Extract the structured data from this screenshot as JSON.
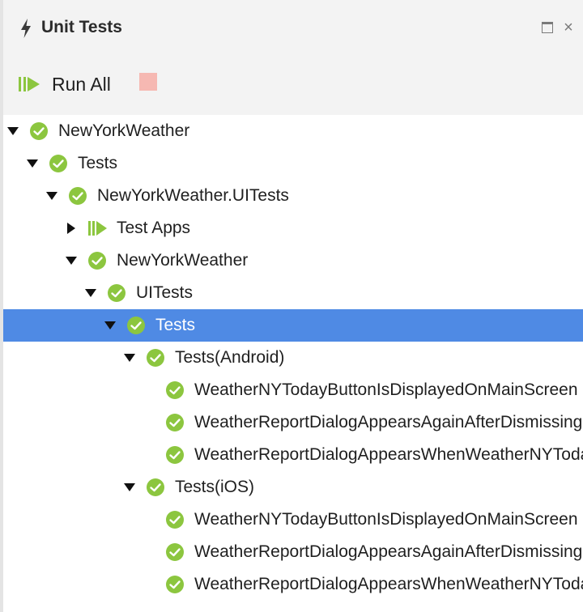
{
  "panel": {
    "title": "Unit Tests",
    "title_icon": "lightning-icon"
  },
  "toolbar": {
    "run_all_label": "Run All",
    "stop_color": "#f6b8b2"
  },
  "colors": {
    "pass_green": "#8cc63f",
    "selection_blue": "#4f8ae4",
    "run_green": "#8cc63f"
  },
  "tree": [
    {
      "label": "NewYorkWeather",
      "depth": 0,
      "toggle": "expanded",
      "icon": "passed-check-icon",
      "selected": false
    },
    {
      "label": "Tests",
      "depth": 1,
      "toggle": "expanded",
      "icon": "passed-check-icon",
      "selected": false
    },
    {
      "label": "NewYorkWeather.UITests",
      "depth": 2,
      "toggle": "expanded",
      "icon": "passed-check-icon",
      "selected": false
    },
    {
      "label": "Test Apps",
      "depth": 3,
      "toggle": "collapsed",
      "icon": "run-apps-icon",
      "selected": false
    },
    {
      "label": "NewYorkWeather",
      "depth": 3,
      "toggle": "expanded",
      "icon": "passed-check-icon",
      "selected": false
    },
    {
      "label": "UITests",
      "depth": 4,
      "toggle": "expanded",
      "icon": "passed-check-icon",
      "selected": false
    },
    {
      "label": "Tests",
      "depth": 5,
      "toggle": "expanded",
      "icon": "passed-check-icon",
      "selected": true
    },
    {
      "label": "Tests(Android)",
      "depth": 6,
      "toggle": "expanded",
      "icon": "passed-check-icon",
      "selected": false
    },
    {
      "label": "WeatherNYTodayButtonIsDisplayedOnMainScreen",
      "depth": 7,
      "toggle": "none",
      "icon": "passed-check-icon",
      "selected": false
    },
    {
      "label": "WeatherReportDialogAppearsAgainAfterDismissing",
      "depth": 7,
      "toggle": "none",
      "icon": "passed-check-icon",
      "selected": false
    },
    {
      "label": "WeatherReportDialogAppearsWhenWeatherNYTodayIsTapped",
      "depth": 7,
      "toggle": "none",
      "icon": "passed-check-icon",
      "selected": false
    },
    {
      "label": "Tests(iOS)",
      "depth": 6,
      "toggle": "expanded",
      "icon": "passed-check-icon",
      "selected": false
    },
    {
      "label": "WeatherNYTodayButtonIsDisplayedOnMainScreen",
      "depth": 7,
      "toggle": "none",
      "icon": "passed-check-icon",
      "selected": false
    },
    {
      "label": "WeatherReportDialogAppearsAgainAfterDismissing",
      "depth": 7,
      "toggle": "none",
      "icon": "passed-check-icon",
      "selected": false
    },
    {
      "label": "WeatherReportDialogAppearsWhenWeatherNYTodayIsTapped",
      "depth": 7,
      "toggle": "none",
      "icon": "passed-check-icon",
      "selected": false
    }
  ]
}
